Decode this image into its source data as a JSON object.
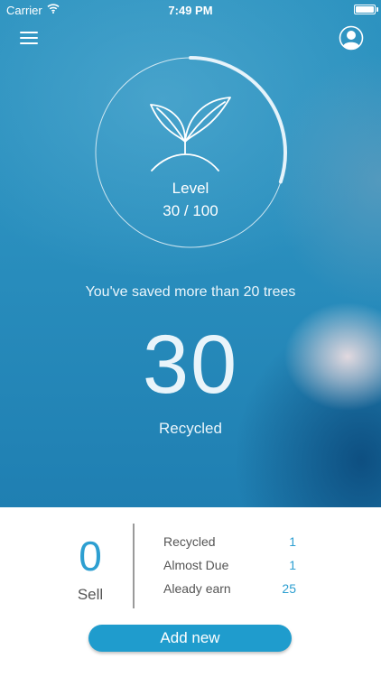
{
  "status_bar": {
    "carrier": "Carrier",
    "time": "7:49 PM"
  },
  "header": {
    "menu_icon": "hamburger-menu-icon",
    "profile_icon": "user-profile-icon"
  },
  "level": {
    "label": "Level",
    "value": "30 / 100",
    "progress": 0.3,
    "icon": "sprout-icon"
  },
  "summary": {
    "saved_text": "You've saved more than 20 trees",
    "count": "30",
    "count_label": "Recycled"
  },
  "sell": {
    "count": "0",
    "label": "Sell"
  },
  "stats": [
    {
      "label": "Recycled",
      "value": "1"
    },
    {
      "label": "Almost Due",
      "value": "1"
    },
    {
      "label": "Aleady earn",
      "value": "25"
    }
  ],
  "actions": {
    "add_label": "Add new"
  },
  "colors": {
    "hero": "#2f95c2",
    "accent": "#2d9fd1",
    "button": "#1f9ccd"
  }
}
